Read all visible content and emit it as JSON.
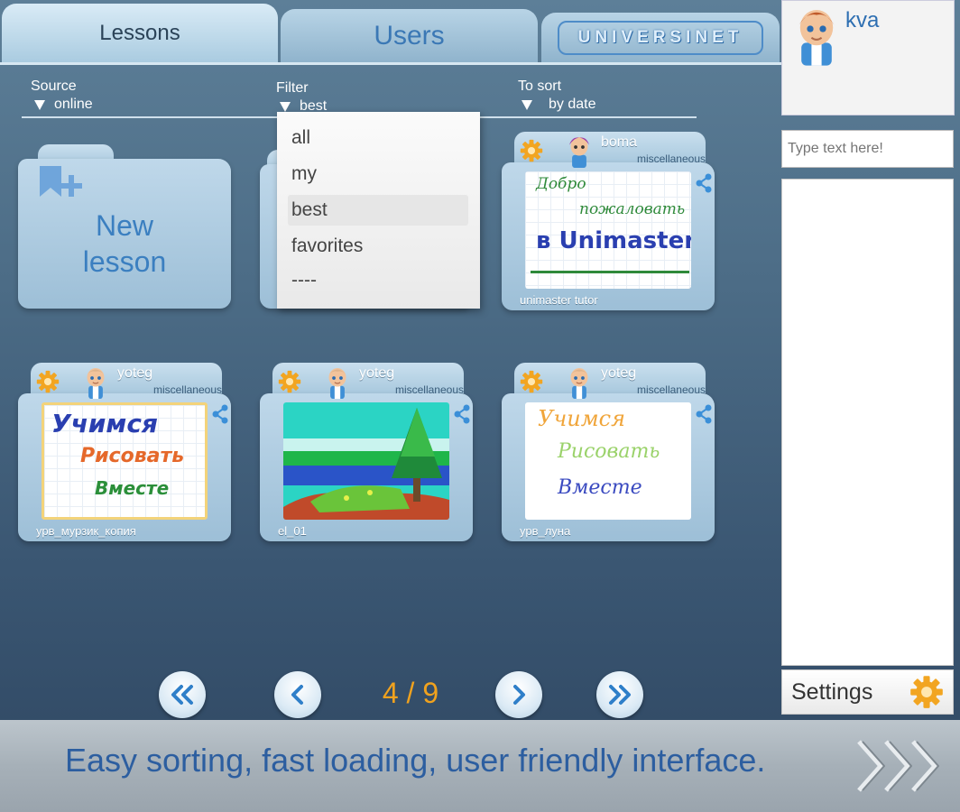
{
  "tabs": {
    "lessons": "Lessons",
    "users": "Users",
    "logo": "UNIVERSINET"
  },
  "controls": {
    "source_label": "Source",
    "source_value": "online",
    "filter_label": "Filter",
    "filter_value": "best",
    "sort_label": "To sort",
    "sort_value": "by date"
  },
  "filter_options": [
    "all",
    "my",
    "best",
    "favorites",
    "----"
  ],
  "new_lesson": {
    "line1": "New",
    "line2": "lesson"
  },
  "lessons": [
    {
      "owner": "boma",
      "category": "miscellaneous",
      "name": "unimaster tutor",
      "thumb_lines": [
        "Добро",
        "пожаловать",
        "в Unimaster"
      ]
    },
    {
      "owner": "yoteg",
      "category": "miscellaneous",
      "name": "урв_мурзик_копия",
      "thumb_lines": [
        "Учимся",
        "Рисовать",
        "Вместе"
      ]
    },
    {
      "owner": "yoteg",
      "category": "miscellaneous",
      "name": "el_01"
    },
    {
      "owner": "yoteg",
      "category": "miscellaneous",
      "name": "урв_луна",
      "thumb_lines": [
        "Учимся",
        "Рисовать",
        "Вместе"
      ]
    }
  ],
  "pager": {
    "current": 4,
    "total": 9,
    "label": "4 / 9"
  },
  "user": {
    "name": "kva"
  },
  "chat": {
    "placeholder": "Type text here!"
  },
  "settings": {
    "label": "Settings"
  },
  "banner": {
    "text": "Easy sorting, fast loading, user friendly interface."
  },
  "colors": {
    "accent": "#3b7fc0",
    "pager_text": "#f0a21e",
    "gear": "#f2a521"
  },
  "icons": {
    "gear": "gear-icon",
    "share": "share-icon",
    "bookmark": "bookmark-add-icon",
    "first": "double-chevron-left-icon",
    "prev": "chevron-left-icon",
    "next": "chevron-right-icon",
    "last": "double-chevron-right-icon",
    "banner_arrows": "triple-chevron-right-icon"
  }
}
